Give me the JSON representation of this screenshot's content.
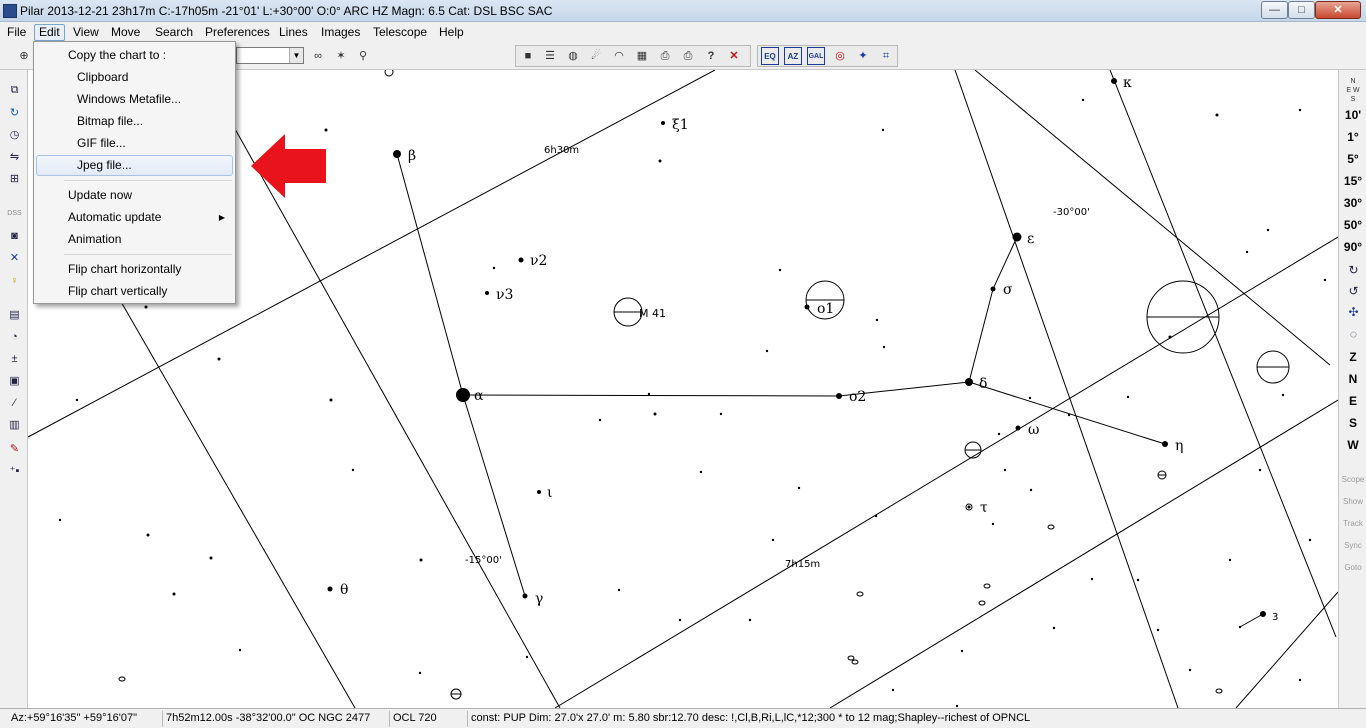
{
  "window": {
    "title": "Pilar 2013-12-21  23h17m C:-17h05m -21°01' L:+30°00' O:0° ARC HZ  Magn: 6.5 Cat: DSL BSC SAC",
    "min": "—",
    "max": "□",
    "close": "✕"
  },
  "menubar": [
    "File",
    "Edit",
    "View",
    "Move",
    "Search",
    "Preferences",
    "Lines",
    "Images",
    "Telescope",
    "Help"
  ],
  "edit_menu": {
    "header": "Copy the chart to :",
    "copy_items": [
      "Clipboard",
      "Windows Metafile...",
      "Bitmap file...",
      "GIF file...",
      "Jpeg file..."
    ],
    "update_now": "Update now",
    "auto_update": "Automatic update",
    "animation": "Animation",
    "flip_h": "Flip chart horizontally",
    "flip_v": "Flip chart vertically",
    "highlighted": "Jpeg file..."
  },
  "toolbar": {
    "groups": [
      "field-combo",
      "search",
      "file",
      "telescope",
      "projection"
    ],
    "icons": [
      "zoom-icon",
      "binoculars-icon",
      "search-star-icon",
      "search-person-icon",
      "save-icon",
      "notes-icon",
      "globe-icon",
      "comet-icon",
      "observatory-icon",
      "calendar-icon",
      "print-icon",
      "print-setup-icon",
      "help-icon",
      "close-icon",
      "eq-icon",
      "az-icon",
      "gal-icon",
      "ecl-icon",
      "target-icon",
      "star-shape-icon",
      "frame-icon"
    ],
    "projection_labels": [
      "EQ",
      "AZ",
      "GAL"
    ]
  },
  "left_toolbar": [
    "zoom-in-icon",
    "copy-icon",
    "refresh-icon",
    "clock-icon",
    "mirror-icon",
    "grid-icon",
    "dss-icon",
    "camera-icon",
    "person-icon",
    "bulb-icon",
    "catalog-icon",
    "gauge-icon",
    "plus-minus-icon",
    "chart-icon",
    "tools-icon",
    "notes-icon",
    "wrench-icon",
    "add-icon"
  ],
  "right_toolbar": {
    "fields": [
      "10'",
      "1°",
      "5°",
      "15°",
      "30°",
      "50°",
      "90°"
    ],
    "directions": [
      "Z",
      "N",
      "E",
      "S",
      "W"
    ],
    "telescope": [
      "Scope",
      "Show",
      "Track",
      "Sync",
      "Goto"
    ],
    "orient_labels": [
      "N",
      "E W",
      "S"
    ]
  },
  "chart": {
    "stars": {
      "alpha": "α",
      "beta": "β",
      "gamma": "γ",
      "delta": "δ",
      "epsilon": "ε",
      "sigma": "σ",
      "eta": "η",
      "omega": "ω",
      "tau": "τ",
      "iota": "ι",
      "theta": "θ",
      "kappa": "κ",
      "nu2": "ν2",
      "nu3": "ν3",
      "xi1": "ξ1",
      "omicron1": "o1",
      "omicron2": "o2",
      "three": "3"
    },
    "objects": {
      "m41": "M 41"
    },
    "grid_labels": {
      "ra_6h30": "6h30m",
      "ra_7h15": "7h15m",
      "dec_m30": "-30°00'",
      "dec_m15": "-15°00'"
    }
  },
  "statusbar": {
    "azalt": "Az:+59°16'35\" +59°16'07\"",
    "coords": "7h52m12.00s -38°32'00.0\"  OC NGC 2477",
    "ocl": "OCL  720",
    "desc": "const: PUP Dim: 27.0'x 27.0'  m: 5.80 sbr:12.70 desc: !,Cl,B,Ri,L,lC,*12;300 * to 12 mag;Shapley--richest of OPNCL"
  },
  "colors": {
    "highlight_arrow": "#e8131b",
    "menu_bg": "#f5f5f5",
    "chart_bg": "#ffffff"
  }
}
